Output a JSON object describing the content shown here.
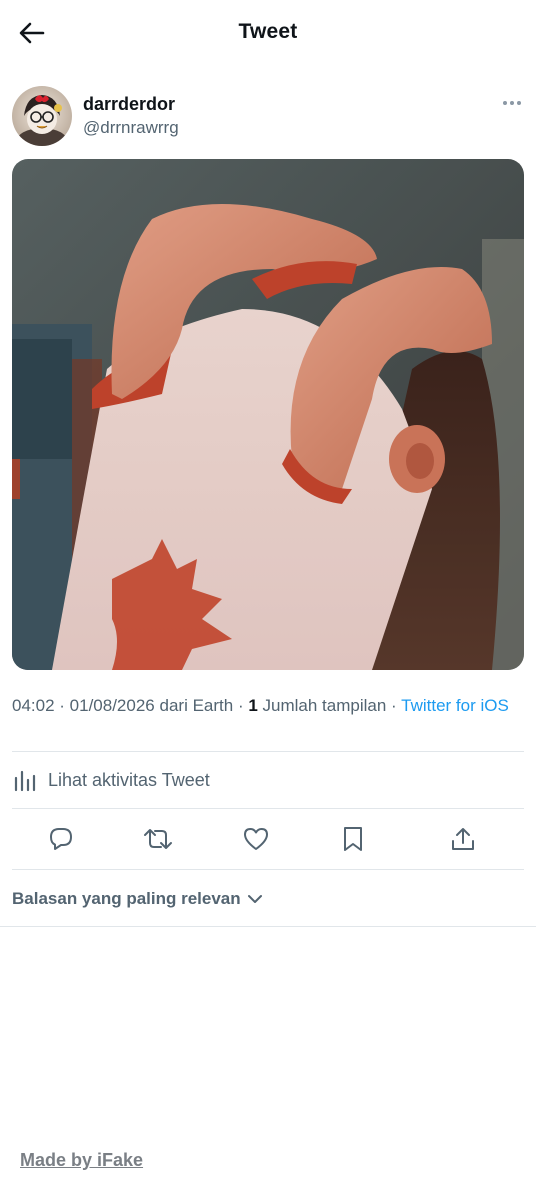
{
  "header": {
    "title": "Tweet",
    "back_icon": "arrow-left-icon"
  },
  "author": {
    "display_name": "darrderdor",
    "handle": "@drrnrawrrg",
    "more_icon": "more-horizontal-icon"
  },
  "tweet": {
    "media_description": "photo",
    "time": "04:02",
    "date": "01/08/2026",
    "location_prefix": "dari Earth",
    "views_count": "1",
    "views_label": "Jumlah tampilan",
    "source": "Twitter for iOS"
  },
  "activity": {
    "label": "Lihat aktivitas Tweet",
    "icon": "analytics-icon"
  },
  "actions": [
    {
      "name": "reply",
      "icon": "reply-icon"
    },
    {
      "name": "retweet",
      "icon": "retweet-icon"
    },
    {
      "name": "like",
      "icon": "heart-icon"
    },
    {
      "name": "bookmark",
      "icon": "bookmark-icon"
    },
    {
      "name": "share",
      "icon": "share-icon"
    }
  ],
  "replies": {
    "sort_label": "Balasan yang paling relevan",
    "chevron_icon": "chevron-down-icon"
  },
  "watermark": {
    "label": "Made by iFake"
  },
  "colors": {
    "accent": "#1d9bf0",
    "secondary_text": "#536471",
    "divider": "#e1e6ea"
  }
}
